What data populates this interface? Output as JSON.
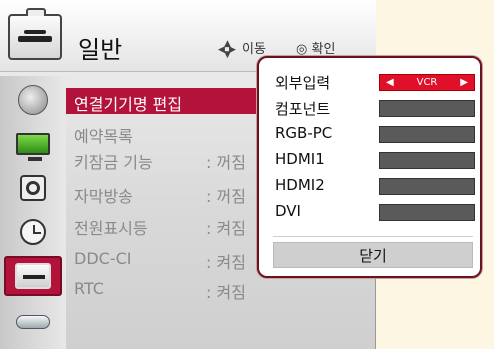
{
  "header": {
    "title": "일반",
    "move_hint": "이동",
    "ok_hint": "확인"
  },
  "sidebar": {
    "icons": [
      "satellite-icon",
      "monitor-icon",
      "speaker-icon",
      "clock-icon",
      "briefcase-icon",
      "plug-icon"
    ],
    "selected_index": 4
  },
  "menu": {
    "items": [
      {
        "label": "연결기기명 편집",
        "value": ""
      },
      {
        "label": "예약목록",
        "value": ""
      },
      {
        "label": "키잠금 기능",
        "value": ": 꺼짐"
      },
      {
        "label": "자막방송",
        "value": ": 꺼짐"
      },
      {
        "label": "전원표시등",
        "value": ": 켜짐"
      },
      {
        "label": "DDC-CI",
        "value": ": 켜짐"
      },
      {
        "label": "RTC",
        "value": ": 켜짐"
      }
    ],
    "selected_index": 0
  },
  "popup": {
    "rows": [
      {
        "label": "외부입력",
        "value": "VCR"
      },
      {
        "label": "컴포넌트",
        "value": ""
      },
      {
        "label": "RGB-PC",
        "value": ""
      },
      {
        "label": "HDMI1",
        "value": ""
      },
      {
        "label": "HDMI2",
        "value": ""
      },
      {
        "label": "DVI",
        "value": ""
      }
    ],
    "close_label": "닫기",
    "arrow_left": "◀",
    "arrow_right": "▶"
  },
  "colors": {
    "accent": "#b3123a",
    "active_field": "#e0102a",
    "field": "#5a5a5a",
    "background": "#fdf6e3"
  }
}
